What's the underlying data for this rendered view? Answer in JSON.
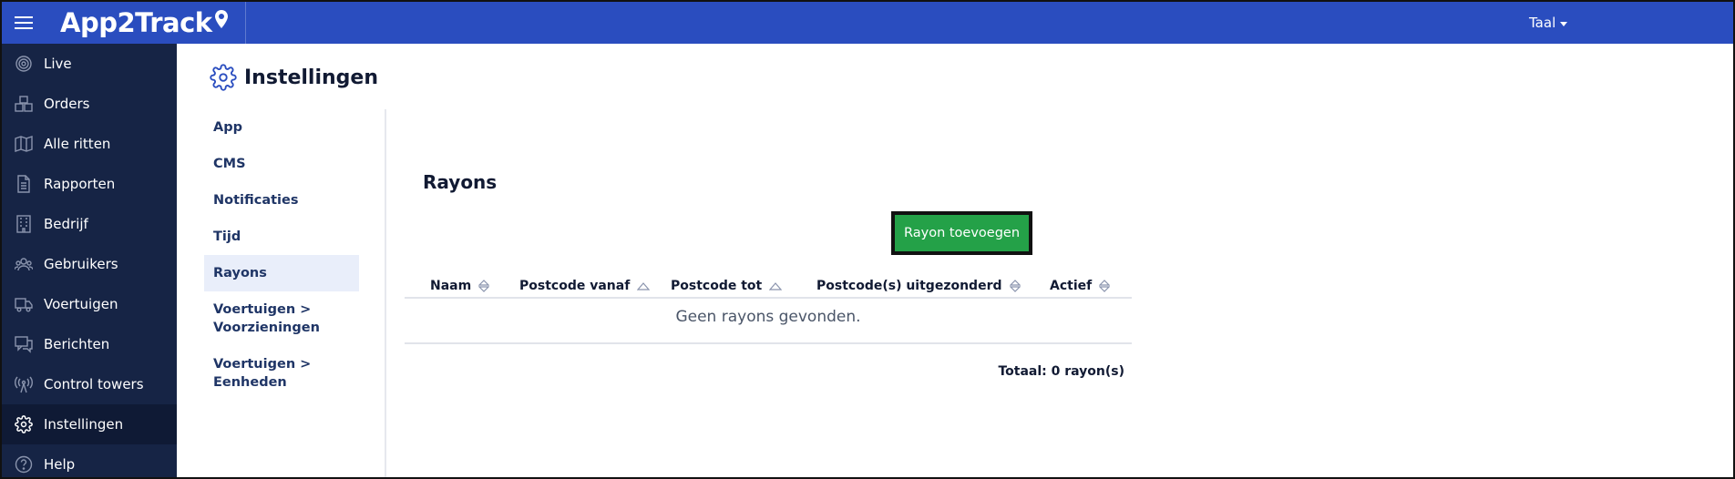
{
  "app": {
    "brand": "App2Track",
    "language_label": "Taal"
  },
  "colors": {
    "topbar": "#2a4dbf",
    "sidebar": "#162445",
    "primary_button": "#24a148"
  },
  "sidebar": {
    "items": [
      {
        "label": "Live",
        "icon": "live-icon"
      },
      {
        "label": "Orders",
        "icon": "boxes-icon"
      },
      {
        "label": "Alle ritten",
        "icon": "map-icon"
      },
      {
        "label": "Rapporten",
        "icon": "document-icon"
      },
      {
        "label": "Bedrijf",
        "icon": "building-icon"
      },
      {
        "label": "Gebruikers",
        "icon": "users-icon"
      },
      {
        "label": "Voertuigen",
        "icon": "truck-icon"
      },
      {
        "label": "Berichten",
        "icon": "chat-icon"
      },
      {
        "label": "Control towers",
        "icon": "antenna-icon"
      },
      {
        "label": "Instellingen",
        "icon": "gear-icon",
        "active": true
      },
      {
        "label": "Help",
        "icon": "help-icon"
      }
    ]
  },
  "page": {
    "title": "Instellingen"
  },
  "subnav": {
    "items": [
      {
        "label": "App"
      },
      {
        "label": "CMS"
      },
      {
        "label": "Notificaties"
      },
      {
        "label": "Tijd"
      },
      {
        "label": "Rayons",
        "active": true
      },
      {
        "label": "Voertuigen >",
        "label2": "Voorzieningen"
      },
      {
        "label": "Voertuigen >",
        "label2": "Eenheden"
      }
    ]
  },
  "rayons": {
    "title": "Rayons",
    "add_button": "Rayon toevoegen",
    "columns": [
      "Naam",
      "Postcode vanaf",
      "Postcode tot",
      "Postcode(s) uitgezonderd",
      "Actief"
    ],
    "empty_text": "Geen rayons gevonden.",
    "total": "Totaal: 0 rayon(s)"
  }
}
